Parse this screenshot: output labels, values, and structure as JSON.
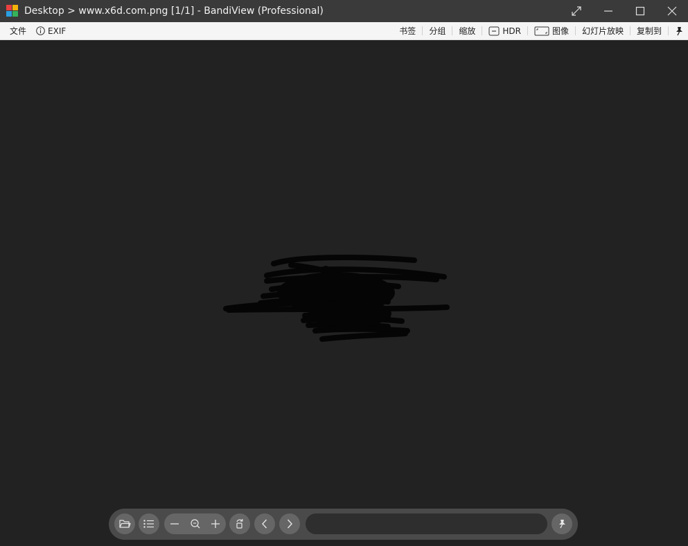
{
  "window": {
    "title": "Desktop > www.x6d.com.png [1/1] - BandiView (Professional)",
    "controls": [
      "fullscreen-icon",
      "minimize-icon",
      "maximize-icon",
      "close-icon"
    ]
  },
  "menu": {
    "left": [
      {
        "label": "文件"
      },
      {
        "label": "EXIF",
        "icon": "info-icon"
      }
    ],
    "right": [
      {
        "label": "书签"
      },
      {
        "label": "分组"
      },
      {
        "label": "缩放"
      },
      {
        "label": "HDR",
        "icon": "hdr-box-icon"
      },
      {
        "label": "图像",
        "icon": "image-fit-icon"
      },
      {
        "label": "幻灯片放映"
      },
      {
        "label": "复制到"
      },
      {
        "label": "",
        "icon": "pin-icon"
      }
    ]
  },
  "toolbar": {
    "buttons": [
      "folder-icon",
      "list-icon",
      "zoom-out-icon",
      "zoom-fit-icon",
      "zoom-in-icon",
      "rotate-icon",
      "prev-icon",
      "next-icon",
      "pin-icon"
    ],
    "filename_field": ""
  },
  "colors": {
    "titlebar": "#3a3a3a",
    "menubar": "#f5f5f5",
    "viewer_background": "#222222",
    "toolbar": "#4a4a4a",
    "toolbar_button": "#666666"
  }
}
